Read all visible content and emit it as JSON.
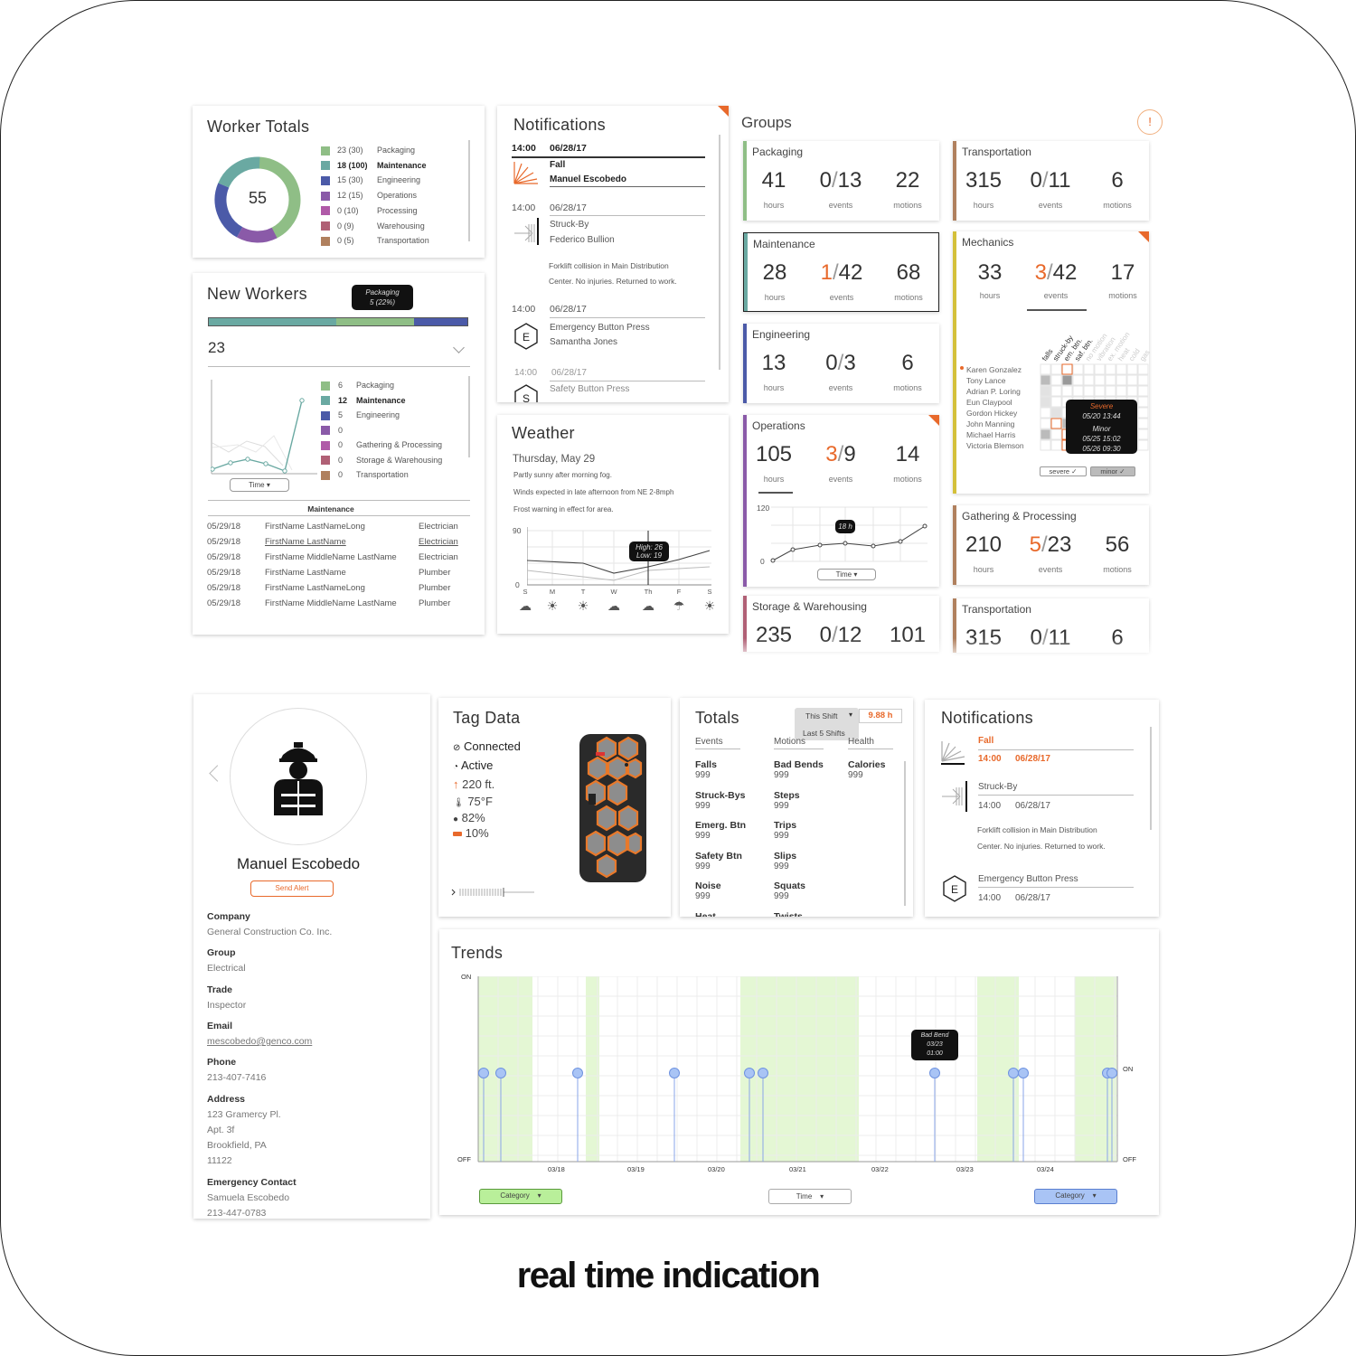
{
  "worker_totals": {
    "title": "Worker Totals",
    "total": "55",
    "items": [
      {
        "count": "23 (30)",
        "label": "Packaging",
        "color": "#8fbe86",
        "bold": false
      },
      {
        "count": "18  (100)",
        "label": "Maintenance",
        "color": "#6aa9a2",
        "bold": true
      },
      {
        "count": "15 (30)",
        "label": "Engineering",
        "color": "#4b5aa8",
        "bold": false
      },
      {
        "count": "12 (15)",
        "label": "Operations",
        "color": "#8a5aa8",
        "bold": false
      },
      {
        "count": "0 (10)",
        "label": "Processing",
        "color": "#b05aa8",
        "bold": false
      },
      {
        "count": "0 (9)",
        "label": "Warehousing",
        "color": "#b06075",
        "bold": false
      },
      {
        "count": "0 (5)",
        "label": "Transportation",
        "color": "#b0805e",
        "bold": false
      }
    ]
  },
  "new_workers": {
    "title": "New Workers",
    "tooltip_line1": "Packaging",
    "tooltip_line2": "5  (22%)",
    "count": "23",
    "items": [
      {
        "count": "6",
        "label": "Packaging",
        "color": "#8fbe86"
      },
      {
        "count": "12",
        "label": "Maintenance",
        "color": "#6aa9a2"
      },
      {
        "count": "5",
        "label": "Engineering",
        "color": "#4b5aa8"
      },
      {
        "count": "0",
        "label": "",
        "color": "#8a5aa8"
      },
      {
        "count": "0",
        "label": "Gathering & Processing",
        "color": "#b05aa8"
      },
      {
        "count": "0",
        "label": "Storage & Warehousing",
        "color": "#b06075"
      },
      {
        "count": "0",
        "label": "Transportation",
        "color": "#b0805e"
      }
    ],
    "time_select": "Time",
    "table_title": "Maintenance",
    "rows": [
      {
        "date": "05/29/18",
        "name": "FirstName LastNameLong",
        "trade": "Electrician",
        "link": false
      },
      {
        "date": "05/29/18",
        "name": "FirstName LastName",
        "trade": "Electrician",
        "link": true
      },
      {
        "date": "05/29/18",
        "name": "FirstName MiddleName LastName",
        "trade": "Electrician",
        "link": false
      },
      {
        "date": "05/29/18",
        "name": "FirstName LastName",
        "trade": "Plumber",
        "link": false
      },
      {
        "date": "05/29/18",
        "name": "FirstName LastNameLong",
        "trade": "Plumber",
        "link": false
      },
      {
        "date": "05/29/18",
        "name": "FirstName MiddleName LastName",
        "trade": "Plumber",
        "link": false
      }
    ]
  },
  "notifications_top": {
    "title": "Notifications",
    "items": [
      {
        "time": "14:00",
        "date": "06/28/17",
        "type": "Fall",
        "person": "Manuel Escobedo",
        "bold": true
      },
      {
        "time": "14:00",
        "date": "06/28/17",
        "type": "Struck-By",
        "person": "Federico Bullion",
        "detail1": "Forklift collision in Main Distribution",
        "detail2": "Center. No injuries. Returned to work."
      },
      {
        "time": "14:00",
        "date": "06/28/17",
        "type": "Emergency Button Press",
        "person": "Samantha Jones",
        "icon_letter": "E"
      },
      {
        "time": "14:00",
        "date": "06/28/17",
        "type": "Safety Button Press",
        "person": "",
        "icon_letter": "S"
      }
    ]
  },
  "weather": {
    "title": "Weather",
    "date": "Thursday, May 29",
    "line1": "Partly sunny after morning fog.",
    "line2": "Winds expected in late afternoon from NE 2-8mph",
    "line3": "Frost warning in effect for area.",
    "y_max": "90",
    "y_min": "0",
    "days": [
      "S",
      "M",
      "T",
      "W",
      "Th",
      "F",
      "S"
    ],
    "tooltip_high": "High: 26",
    "tooltip_low": "Low: 19"
  },
  "groups": {
    "title": "Groups",
    "alert_icon": "!",
    "hours_label": "hours",
    "events_label": "events",
    "motions_label": "motions",
    "cards": [
      {
        "name": "Packaging",
        "hours": "41",
        "ev_a": "0",
        "ev_b": "13",
        "motions": "22",
        "color": "#8fbe86",
        "hot": false
      },
      {
        "name": "Transportation",
        "hours": "315",
        "ev_a": "0",
        "ev_b": "11",
        "motions": "6",
        "color": "#b0805e",
        "hot": false
      },
      {
        "name": "Maintenance",
        "hours": "28",
        "ev_a": "1",
        "ev_b": "42",
        "motions": "68",
        "color": "#6aa9a2",
        "hot": true
      },
      {
        "name": "Engineering",
        "hours": "13",
        "ev_a": "0",
        "ev_b": "3",
        "motions": "6",
        "color": "#4b5aa8",
        "hot": false
      },
      {
        "name": "Operations",
        "hours": "105",
        "ev_a": "3",
        "ev_b": "9",
        "motions": "14",
        "color": "#8a5aa8",
        "hot": true
      },
      {
        "name": "Gathering & Processing",
        "hours": "210",
        "ev_a": "5",
        "ev_b": "23",
        "motions": "56",
        "color": "#b0805e",
        "hot": true
      },
      {
        "name": "Storage & Warehousing",
        "hours": "235",
        "ev_a": "0",
        "ev_b": "12",
        "motions": "101",
        "color": "#b06075",
        "hot": false
      },
      {
        "name": "Transportation",
        "hours": "315",
        "ev_a": "0",
        "ev_b": "11",
        "motions": "6",
        "color": "#b0805e",
        "hot": false
      }
    ],
    "operations_chart": {
      "y_max": "120",
      "y_min": "0",
      "tooltip": "18 h",
      "time_select": "Time"
    },
    "mechanics": {
      "name": "Mechanics",
      "hours": "33",
      "ev_a": "3",
      "ev_b": "42",
      "motions": "17",
      "color": "#d4c03a",
      "columns": [
        "falls",
        "struck-by",
        "em. btn.",
        "saf. btn.",
        "no motion",
        "vibration",
        "ex. motion",
        "heat",
        "cold",
        "gas"
      ],
      "people": [
        "Karen Gonzalez",
        "Tony Lance",
        "Adrian P. Loring",
        "Eun Claypool",
        "Gordon Hickey",
        "John Manning",
        "Michael Harris",
        "Victoria Blemson"
      ],
      "tooltip_severe": "Severe",
      "tooltip_severe_time": "05/20  13:44",
      "tooltip_minor": "Minor",
      "tooltip_minor_time1": "05/25  15:02",
      "tooltip_minor_time2": "05/26  09:30",
      "filter_severe": "severe",
      "filter_minor": "minor"
    }
  },
  "profile": {
    "name": "Manuel Escobedo",
    "send_alert": "Send Alert",
    "fields": [
      {
        "label": "Company",
        "lines": [
          "General Construction Co. Inc."
        ]
      },
      {
        "label": "Group",
        "lines": [
          "Electrical"
        ]
      },
      {
        "label": "Trade",
        "lines": [
          "Inspector"
        ]
      },
      {
        "label": "Email",
        "lines": [
          "mescobedo@genco.com"
        ]
      },
      {
        "label": "Phone",
        "lines": [
          "213-407-7416"
        ]
      },
      {
        "label": "Address",
        "lines": [
          "123 Gramercy Pl.",
          "Apt. 3f",
          "Brookfield, PA",
          "11122"
        ]
      },
      {
        "label": "Emergency Contact",
        "lines": [
          "Samuela Escobedo",
          "213-447-0783"
        ]
      }
    ]
  },
  "tag_data": {
    "title": "Tag Data",
    "connected": "Connected",
    "active": "Active",
    "altitude": "220 ft.",
    "temperature": "75°F",
    "humidity": "82%",
    "battery": "10%"
  },
  "totals": {
    "title": "Totals",
    "shift_select": "This Shift",
    "shift_option2": "Last 5 Shifts",
    "hours_value": "9.88 h",
    "columns": [
      "Events",
      "Motions",
      "Health"
    ],
    "events": [
      [
        "Falls",
        "999"
      ],
      [
        "Struck-Bys",
        "999"
      ],
      [
        "Emerg. Btn",
        "999"
      ],
      [
        "Safety Btn",
        "999"
      ],
      [
        "Noise",
        "999"
      ],
      [
        "Heat",
        ""
      ]
    ],
    "motions": [
      [
        "Bad Bends",
        "999"
      ],
      [
        "Steps",
        "999"
      ],
      [
        "Trips",
        "999"
      ],
      [
        "Slips",
        "999"
      ],
      [
        "Squats",
        "999"
      ],
      [
        "Twists",
        ""
      ]
    ],
    "health": [
      [
        "Calories",
        "999"
      ]
    ]
  },
  "notifications_bottom": {
    "title": "Notifications",
    "items": [
      {
        "type": "Fall",
        "time": "14:00",
        "date": "06/28/17"
      },
      {
        "type": "Struck-By",
        "time": "14:00",
        "date": "06/28/17",
        "detail1": "Forklift collision in Main Distribution",
        "detail2": "Center. No injuries. Returned to work."
      },
      {
        "type": "Emergency Button Press",
        "time": "14:00",
        "date": "06/28/17",
        "icon_letter": "E"
      }
    ]
  },
  "trends": {
    "title": "Trends",
    "on_label": "ON",
    "off_label": "OFF",
    "dates": [
      "03/18",
      "03/19",
      "03/20",
      "03/21",
      "03/22",
      "03/23",
      "03/24"
    ],
    "tooltip_line1": "Bad Bend",
    "tooltip_line2": "03/23",
    "tooltip_line3": "01:00",
    "left_select": "Category",
    "mid_select": "Time",
    "right_select": "Category"
  },
  "caption": "real time indication",
  "colors": {
    "accent_orange": "#e8692b",
    "green_band": "#e4f7d4",
    "marker_blue": "#a9c4f5"
  }
}
